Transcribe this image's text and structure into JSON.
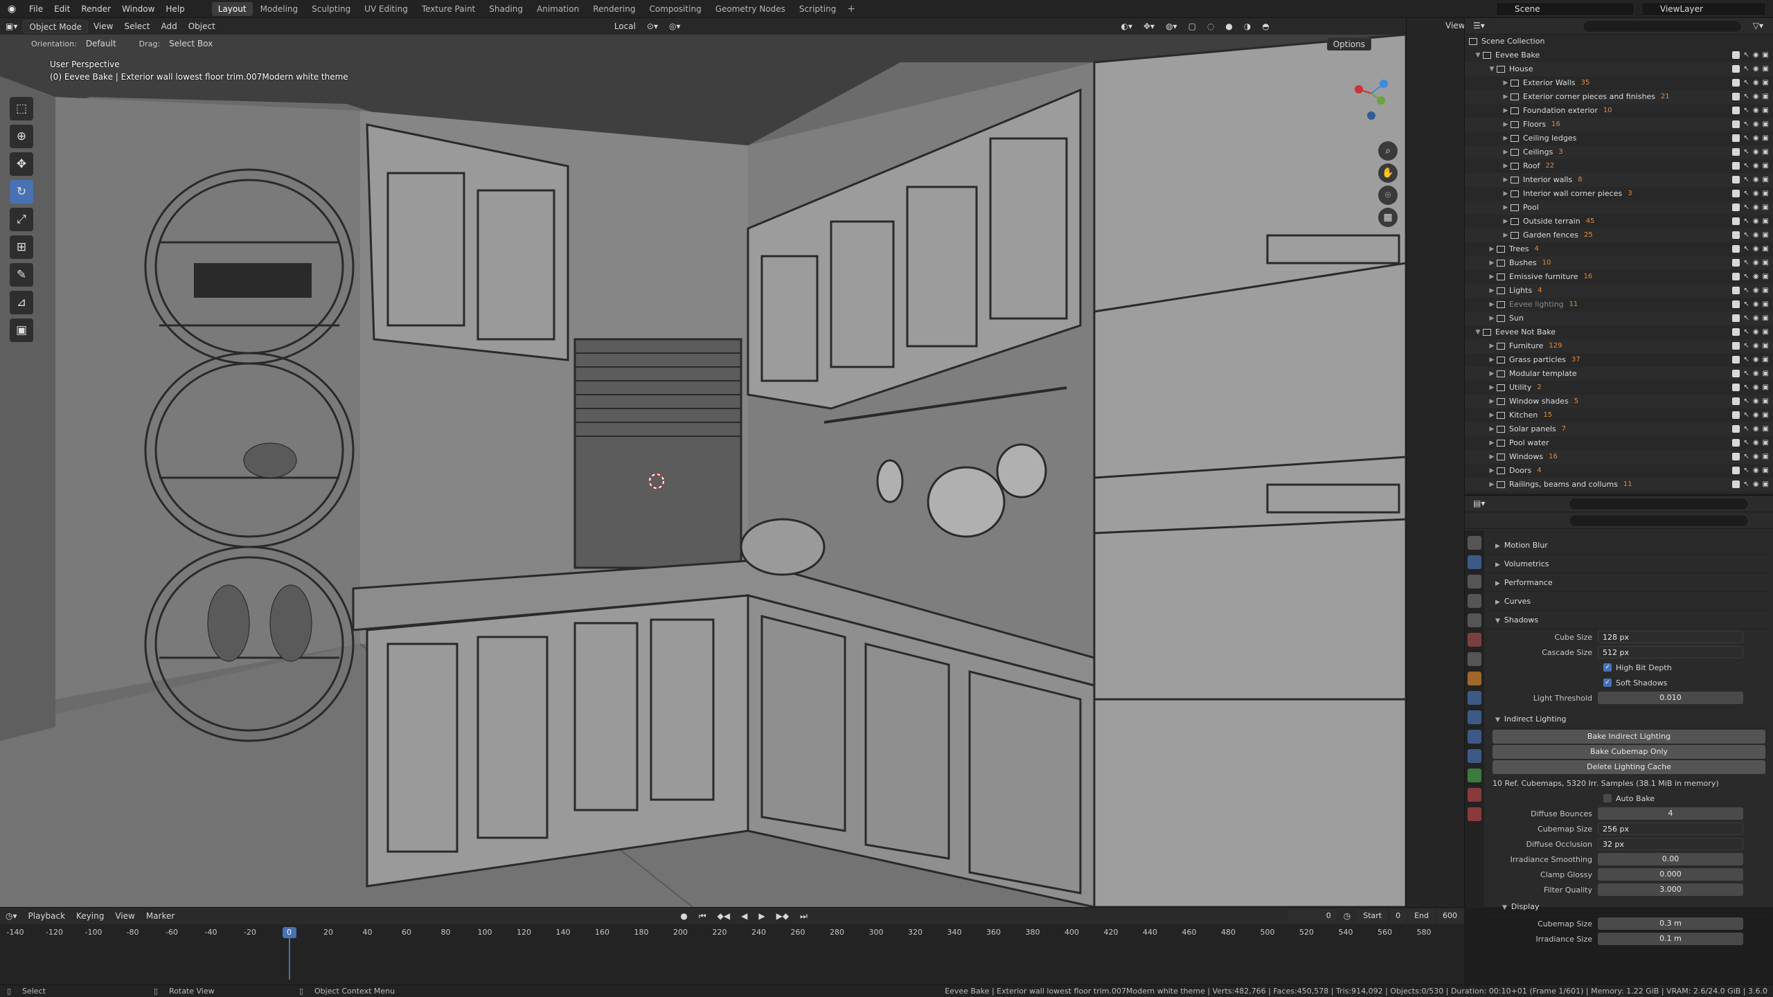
{
  "menu": [
    "File",
    "Edit",
    "Render",
    "Window",
    "Help"
  ],
  "workspaces": [
    "Layout",
    "Modeling",
    "Sculpting",
    "UV Editing",
    "Texture Paint",
    "Shading",
    "Animation",
    "Rendering",
    "Compositing",
    "Geometry Nodes",
    "Scripting"
  ],
  "active_workspace": "Layout",
  "scene": "Scene",
  "view_layer": "ViewLayer",
  "header": {
    "mode": "Object Mode",
    "view": "View",
    "select": "Select",
    "add": "Add",
    "object": "Object",
    "transform": "Local",
    "orientation_label": "Orientation:",
    "orientation": "Default",
    "drag_label": "Drag:",
    "drag": "Select Box",
    "options": "Options",
    "view_btn": "View"
  },
  "viewport": {
    "perspective": "User Perspective",
    "object_info": "(0) Eevee Bake | Exterior wall lowest floor trim.007Modern white theme"
  },
  "tools": [
    "select-box",
    "cursor",
    "move",
    "rotate",
    "scale",
    "transform",
    "annotate",
    "measure",
    "add-cube"
  ],
  "outliner": {
    "root": "Scene Collection",
    "rows": [
      {
        "label": "Eevee Bake",
        "depth": 0,
        "open": true,
        "count": ""
      },
      {
        "label": "House",
        "depth": 1,
        "open": true,
        "count": ""
      },
      {
        "label": "Exterior Walls",
        "depth": 2,
        "count": "35"
      },
      {
        "label": "Exterior corner pieces and finishes",
        "depth": 2,
        "count": "21"
      },
      {
        "label": "Foundation exterior",
        "depth": 2,
        "count": "10"
      },
      {
        "label": "Floors",
        "depth": 2,
        "count": "16"
      },
      {
        "label": "Ceiling ledges",
        "depth": 2,
        "count": ""
      },
      {
        "label": "Ceilings",
        "depth": 2,
        "count": "3"
      },
      {
        "label": "Roof",
        "depth": 2,
        "count": "22"
      },
      {
        "label": "Interior walls",
        "depth": 2,
        "count": "8"
      },
      {
        "label": "Interior wall corner pieces",
        "depth": 2,
        "count": "3"
      },
      {
        "label": "Pool",
        "depth": 2,
        "count": ""
      },
      {
        "label": "Outside terrain",
        "depth": 2,
        "count": "45"
      },
      {
        "label": "Garden fences",
        "depth": 2,
        "count": "25"
      },
      {
        "label": "Trees",
        "depth": 1,
        "count": "4"
      },
      {
        "label": "Bushes",
        "depth": 1,
        "count": "10"
      },
      {
        "label": "Emissive furniture",
        "depth": 1,
        "count": "16"
      },
      {
        "label": "Lights",
        "depth": 1,
        "count": "4"
      },
      {
        "label": "Eevee lighting",
        "depth": 1,
        "count": "11",
        "dim": true
      },
      {
        "label": "Sun",
        "depth": 1,
        "count": ""
      },
      {
        "label": "Eevee Not Bake",
        "depth": 0,
        "open": true,
        "count": ""
      },
      {
        "label": "Furniture",
        "depth": 1,
        "count": "129"
      },
      {
        "label": "Grass particles",
        "depth": 1,
        "count": "37"
      },
      {
        "label": "Modular template",
        "depth": 1,
        "count": ""
      },
      {
        "label": "Utility",
        "depth": 1,
        "count": "2"
      },
      {
        "label": "Window shades",
        "depth": 1,
        "count": "5"
      },
      {
        "label": "Kitchen",
        "depth": 1,
        "count": "15"
      },
      {
        "label": "Solar panels",
        "depth": 1,
        "count": "7"
      },
      {
        "label": "Pool water",
        "depth": 1,
        "count": ""
      },
      {
        "label": "Windows",
        "depth": 1,
        "count": "16"
      },
      {
        "label": "Doors",
        "depth": 1,
        "count": "4"
      },
      {
        "label": "Railings, beams and collums",
        "depth": 1,
        "count": "11"
      }
    ]
  },
  "properties": {
    "collapsed_panels": [
      "Motion Blur",
      "Volumetrics",
      "Performance",
      "Curves"
    ],
    "shadows": {
      "title": "Shadows",
      "cube_size_label": "Cube Size",
      "cube_size": "128 px",
      "cascade_size_label": "Cascade Size",
      "cascade_size": "512 px",
      "high_bit_depth": "High Bit Depth",
      "soft_shadows": "Soft Shadows",
      "light_threshold_label": "Light Threshold",
      "light_threshold": "0.010"
    },
    "indirect": {
      "title": "Indirect Lighting",
      "bake_indirect": "Bake Indirect Lighting",
      "bake_cubemap": "Bake Cubemap Only",
      "delete_cache": "Delete Lighting Cache",
      "info": "10 Ref. Cubemaps, 5320 Irr. Samples (38.1 MiB in memory)",
      "auto_bake": "Auto Bake",
      "diffuse_bounces_label": "Diffuse Bounces",
      "diffuse_bounces": "4",
      "cubemap_size_label": "Cubemap Size",
      "cubemap_size": "256 px",
      "diffuse_occlusion_label": "Diffuse Occlusion",
      "diffuse_occlusion": "32 px",
      "irradiance_smoothing_label": "Irradiance Smoothing",
      "irradiance_smoothing": "0.00",
      "clamp_glossy_label": "Clamp Glossy",
      "clamp_glossy": "0.000",
      "filter_quality_label": "Filter Quality",
      "filter_quality": "3.000"
    },
    "display": {
      "title": "Display",
      "cubemap_size_label": "Cubemap Size",
      "cubemap_size": "0.3 m",
      "irradiance_size_label": "Irradiance Size",
      "irradiance_size": "0.1 m"
    }
  },
  "timeline": {
    "playback": "Playback",
    "keying": "Keying",
    "view": "View",
    "marker": "Marker",
    "current_frame": "0",
    "start_label": "Start",
    "start": "0",
    "end_label": "End",
    "end": "600",
    "ticks": [
      "-140",
      "-120",
      "-100",
      "-80",
      "-60",
      "-40",
      "-20",
      "0",
      "20",
      "40",
      "60",
      "80",
      "100",
      "120",
      "140",
      "160",
      "180",
      "200",
      "220",
      "240",
      "260",
      "280",
      "300",
      "320",
      "340",
      "360",
      "380",
      "400",
      "420",
      "440",
      "460",
      "480",
      "500",
      "520",
      "540",
      "560",
      "580"
    ]
  },
  "status": {
    "select": "Select",
    "rotate": "Rotate View",
    "context": "Object Context Menu",
    "stats": "Eevee Bake | Exterior wall lowest floor trim.007Modern white theme | Verts:482,766 | Faces:450,578 | Tris:914,092 | Objects:0/530 | Duration: 00:10+01 (Frame 1/601) | Memory: 1.22 GiB | VRAM: 2.6/24.0 GiB | 3.6.0"
  },
  "colors": {
    "accent": "#4772b3",
    "count_badge": "#e58b3b",
    "viewport_bg": "#6b6b6b"
  }
}
